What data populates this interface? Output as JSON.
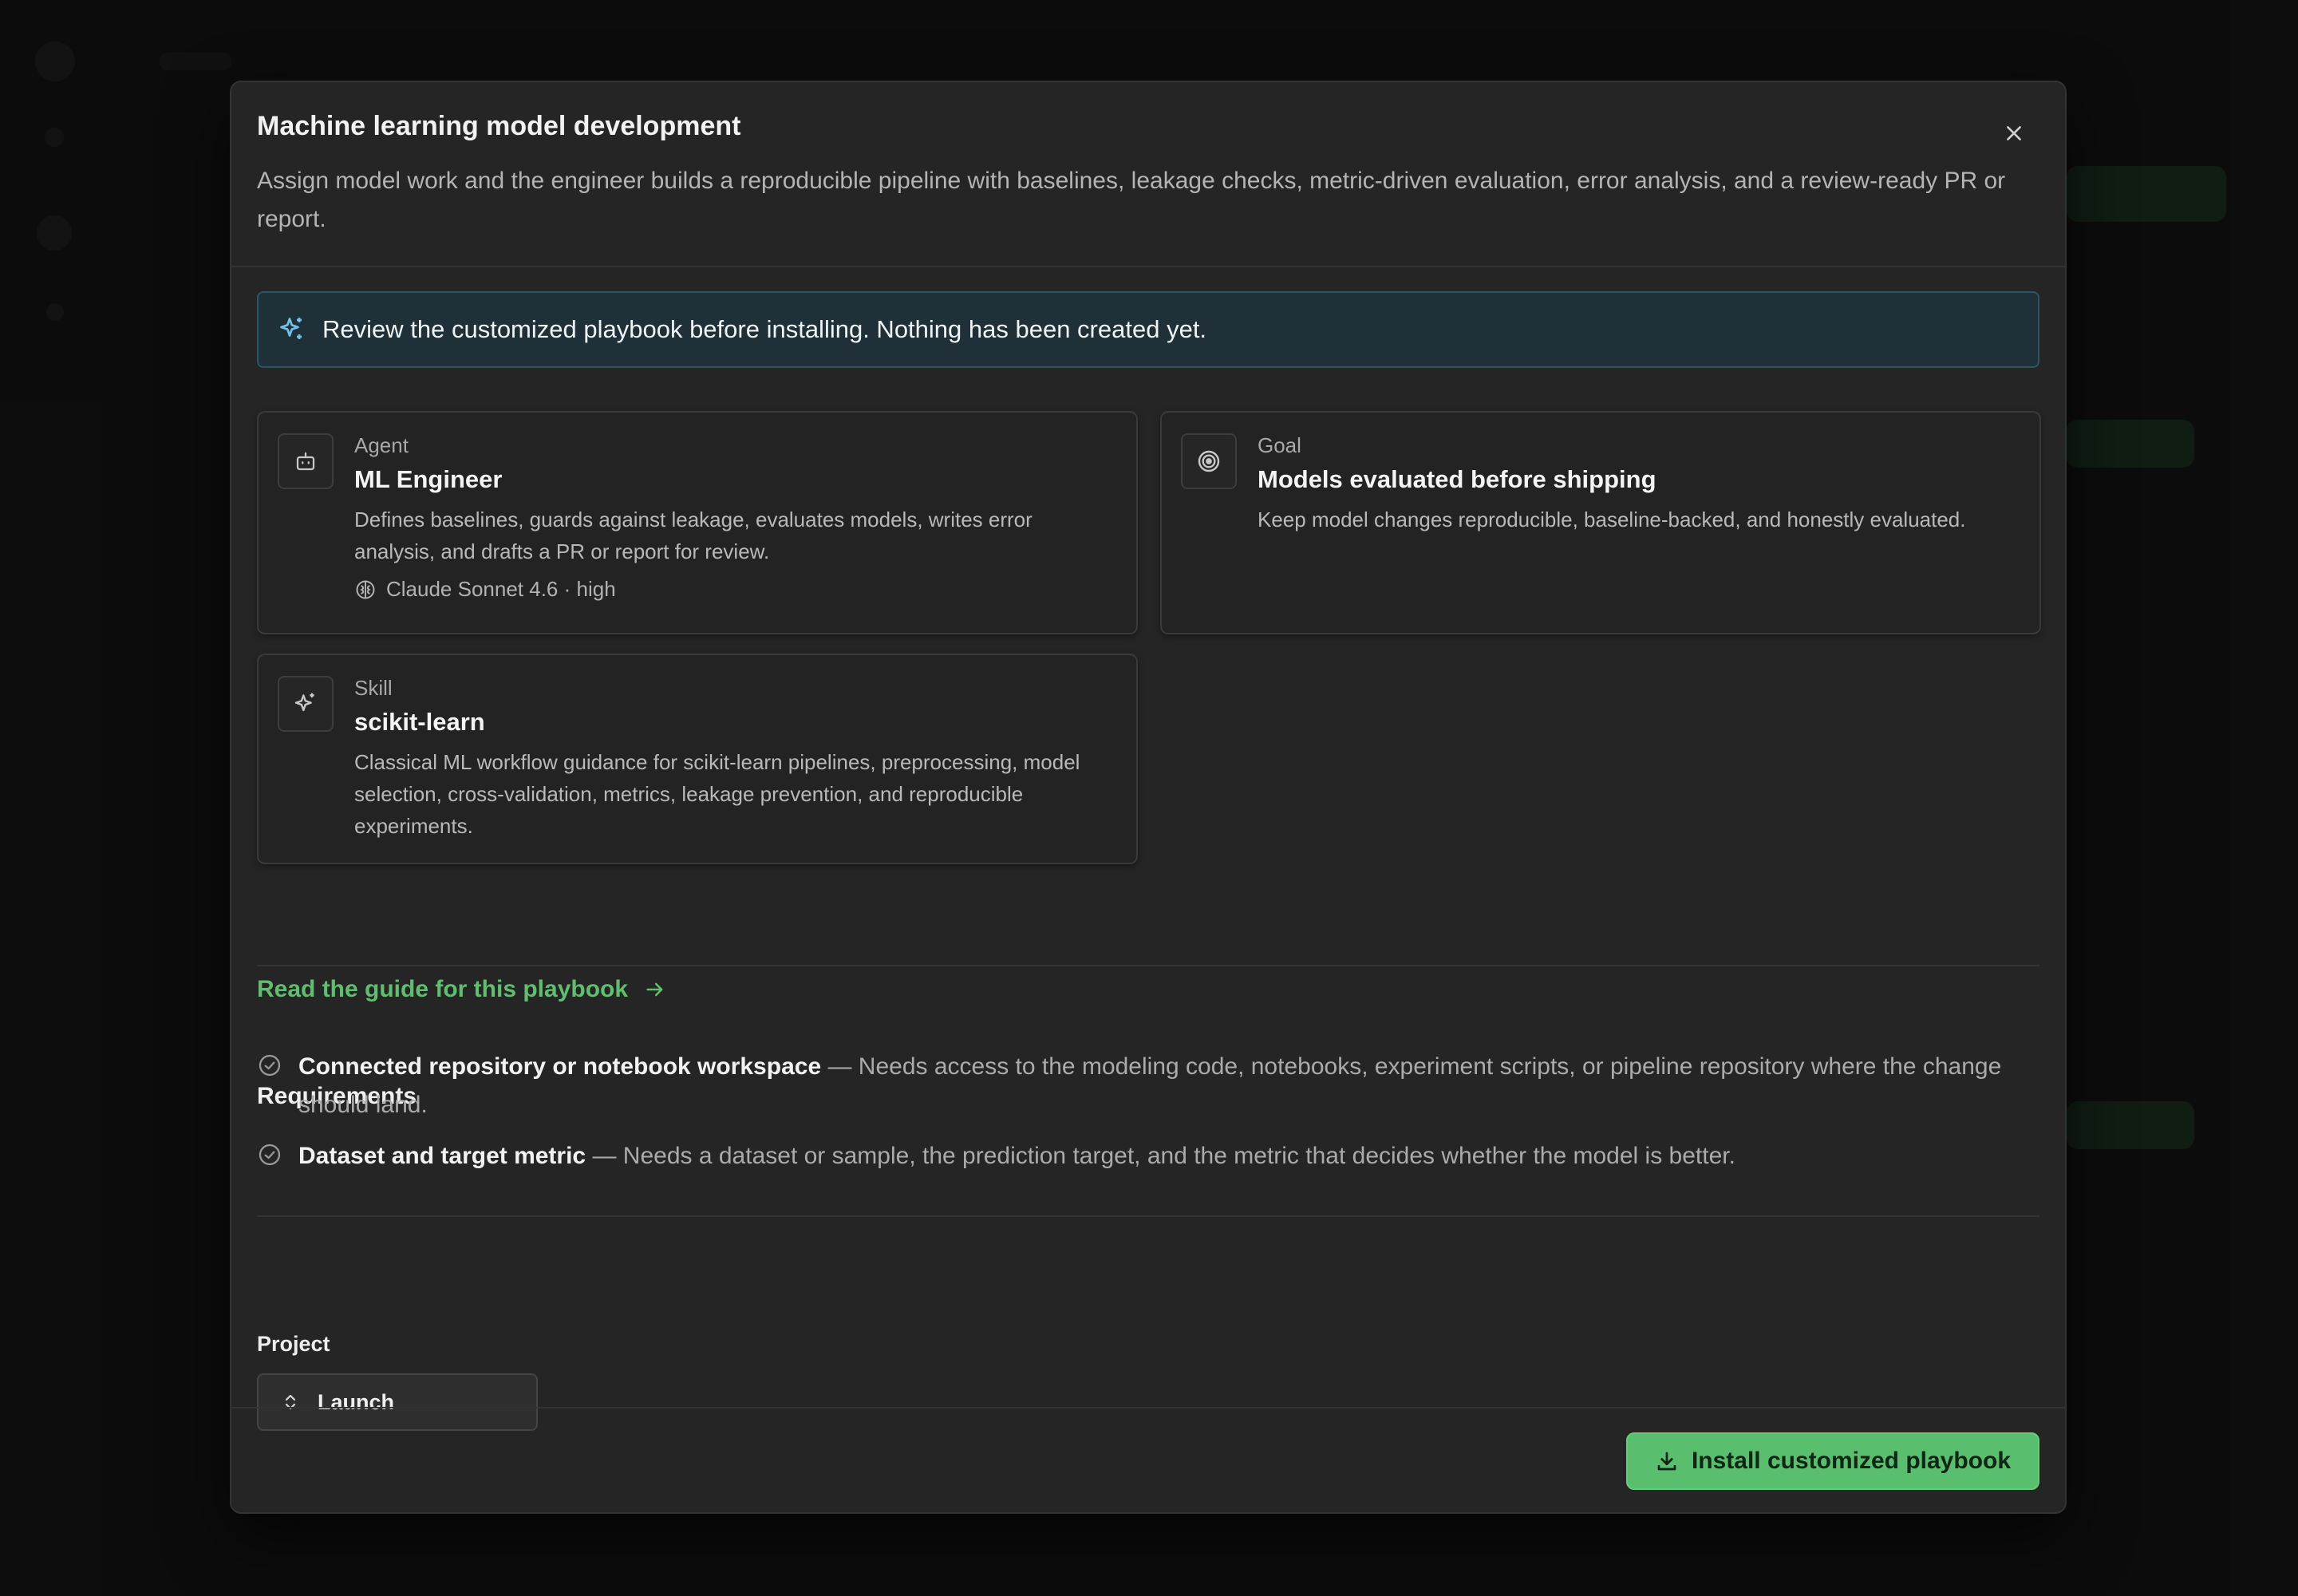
{
  "modal": {
    "title": "Machine learning model development",
    "description": "Assign model work and the engineer builds a reproducible pipeline with baselines, leakage checks, metric-driven evaluation, error analysis, and a review-ready PR or report.",
    "close_icon": "close-icon"
  },
  "notice": {
    "icon": "sparkles-icon",
    "text": "Review the customized playbook before installing. Nothing has been created yet."
  },
  "cards": {
    "agent": {
      "icon": "robot-icon",
      "kicker": "Agent",
      "title": "ML Engineer",
      "description": "Defines baselines, guards against leakage, evaluates models, writes error analysis, and drafts a PR or report for review.",
      "meta_icon": "brain-icon",
      "meta": "Claude Sonnet 4.6 · high"
    },
    "goal": {
      "icon": "target-icon",
      "kicker": "Goal",
      "title": "Models evaluated before shipping",
      "description": "Keep model changes reproducible, baseline-backed, and honestly evaluated."
    },
    "skill": {
      "icon": "sparkles-icon",
      "kicker": "Skill",
      "title": "scikit-learn",
      "description": "Classical ML workflow guidance for scikit-learn pipelines, preprocessing, model selection, cross-validation, metrics, leakage prevention, and reproducible experiments."
    }
  },
  "guide_link": {
    "label": "Read the guide for this playbook",
    "icon": "arrow-right-icon"
  },
  "requirements": {
    "heading": "Requirements",
    "items": [
      {
        "name": "Connected repository or notebook workspace",
        "separator": " — ",
        "detail": "Needs access to the modeling code, notebooks, experiment scripts, or pipeline repository where the change should land."
      },
      {
        "name": "Dataset and target metric",
        "separator": " — ",
        "detail": "Needs a dataset or sample, the prediction target, and the metric that decides whether the model is better."
      }
    ]
  },
  "project": {
    "label": "Project",
    "selected": "Launch",
    "icon": "chevrons-up-down-icon"
  },
  "install_button": {
    "label": "Install customized playbook",
    "icon": "download-icon"
  },
  "colors": {
    "accent_green": "#59bf6e",
    "link_green": "#5fbf6f",
    "notice_bg": "#1f3038",
    "modal_bg": "#252525"
  }
}
